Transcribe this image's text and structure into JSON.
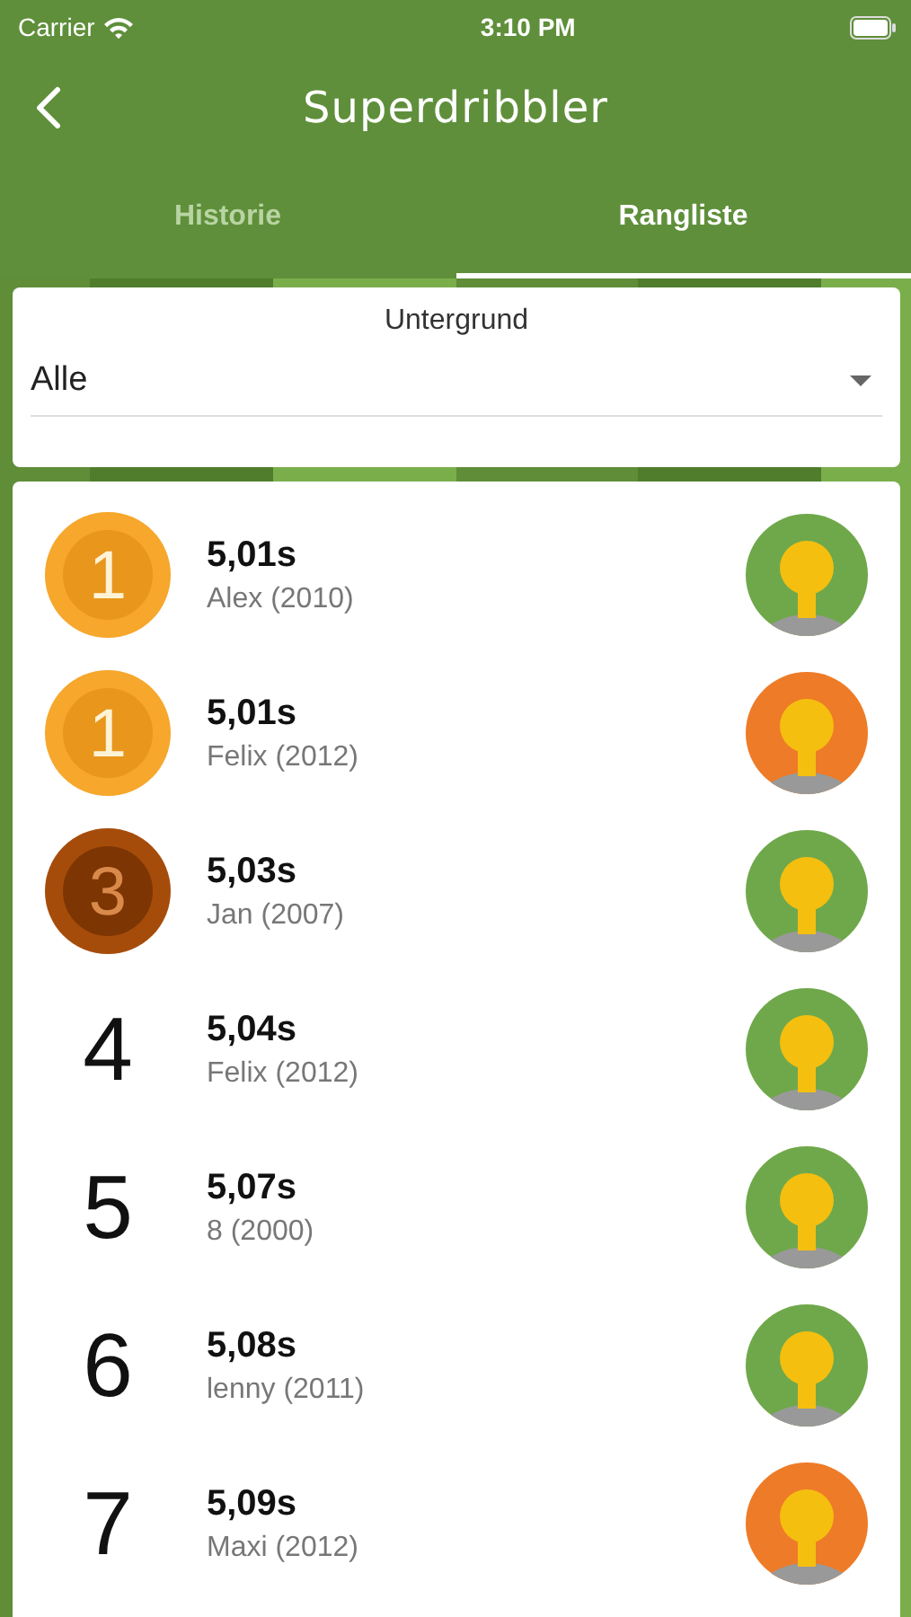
{
  "status_bar": {
    "carrier": "Carrier",
    "time": "3:10 PM"
  },
  "nav": {
    "title": "Superdribbler"
  },
  "tabs": [
    {
      "label": "Historie",
      "selected": false
    },
    {
      "label": "Rangliste",
      "selected": true
    }
  ],
  "filter": {
    "label": "Untergrund",
    "value": "Alle"
  },
  "rows": [
    {
      "kind": "gold",
      "rank": "1",
      "time": "5,01s",
      "name": "Alex (2010)",
      "color": "#6fa84a"
    },
    {
      "kind": "gold",
      "rank": "1",
      "time": "5,01s",
      "name": "Felix (2012)",
      "color": "#ee7b27"
    },
    {
      "kind": "bronze",
      "rank": "3",
      "time": "5,03s",
      "name": "Jan (2007)",
      "color": "#6fa84a"
    },
    {
      "kind": "plain",
      "rank": "4",
      "time": "5,04s",
      "name": "Felix (2012)",
      "color": "#6fa84a"
    },
    {
      "kind": "plain",
      "rank": "5",
      "time": "5,07s",
      "name": "8 (2000)",
      "color": "#6fa84a"
    },
    {
      "kind": "plain",
      "rank": "6",
      "time": "5,08s",
      "name": "lenny (2011)",
      "color": "#6fa84a"
    },
    {
      "kind": "plain",
      "rank": "7",
      "time": "5,09s",
      "name": "Maxi (2012)",
      "color": "#ee7b27"
    }
  ]
}
